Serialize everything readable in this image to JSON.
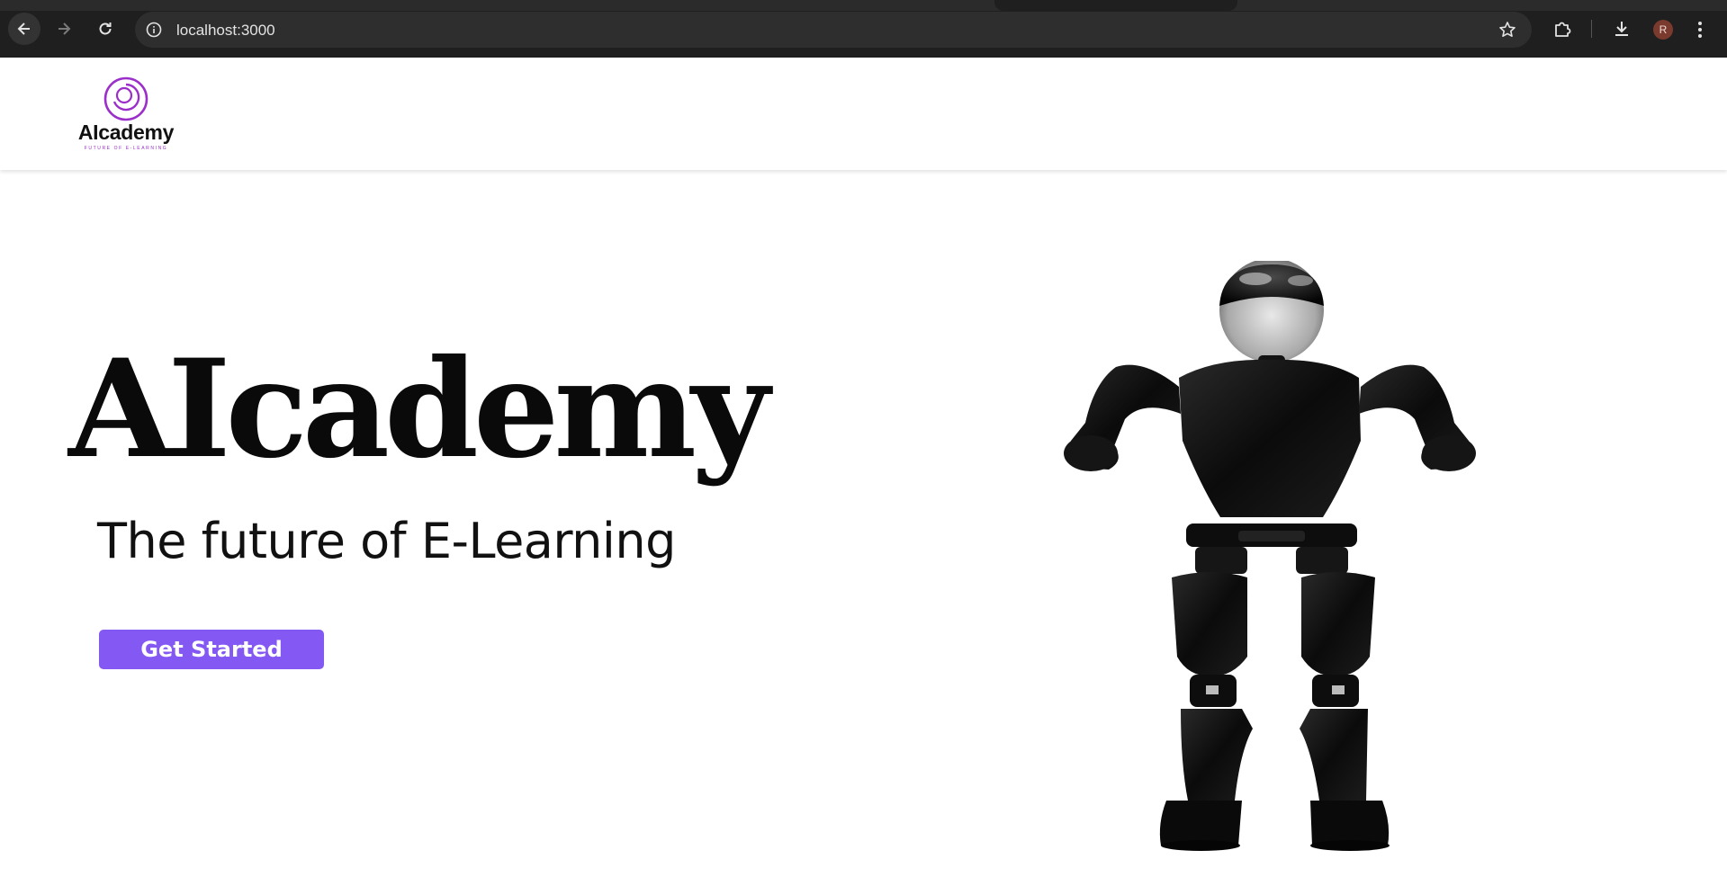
{
  "browser": {
    "url": "localhost:3000",
    "profile_initial": "R",
    "icons": {
      "back": "arrow-left-icon",
      "forward": "arrow-right-icon",
      "reload": "reload-icon",
      "site_info": "info-icon",
      "bookmark": "star-icon",
      "extensions": "puzzle-icon",
      "downloads": "download-icon",
      "menu": "kebab-menu-icon"
    }
  },
  "header": {
    "logo_text": "AIcademy",
    "logo_tagline": "FUTURE OF E-LEARNING"
  },
  "hero": {
    "title": "AIcademy",
    "subtitle": "The future of E-Learning",
    "cta_label": "Get Started",
    "image": "robot-illustration"
  },
  "colors": {
    "accent": "#8458f2",
    "logo": "#9b2fc9",
    "chrome_bg": "#1f1f1f"
  }
}
